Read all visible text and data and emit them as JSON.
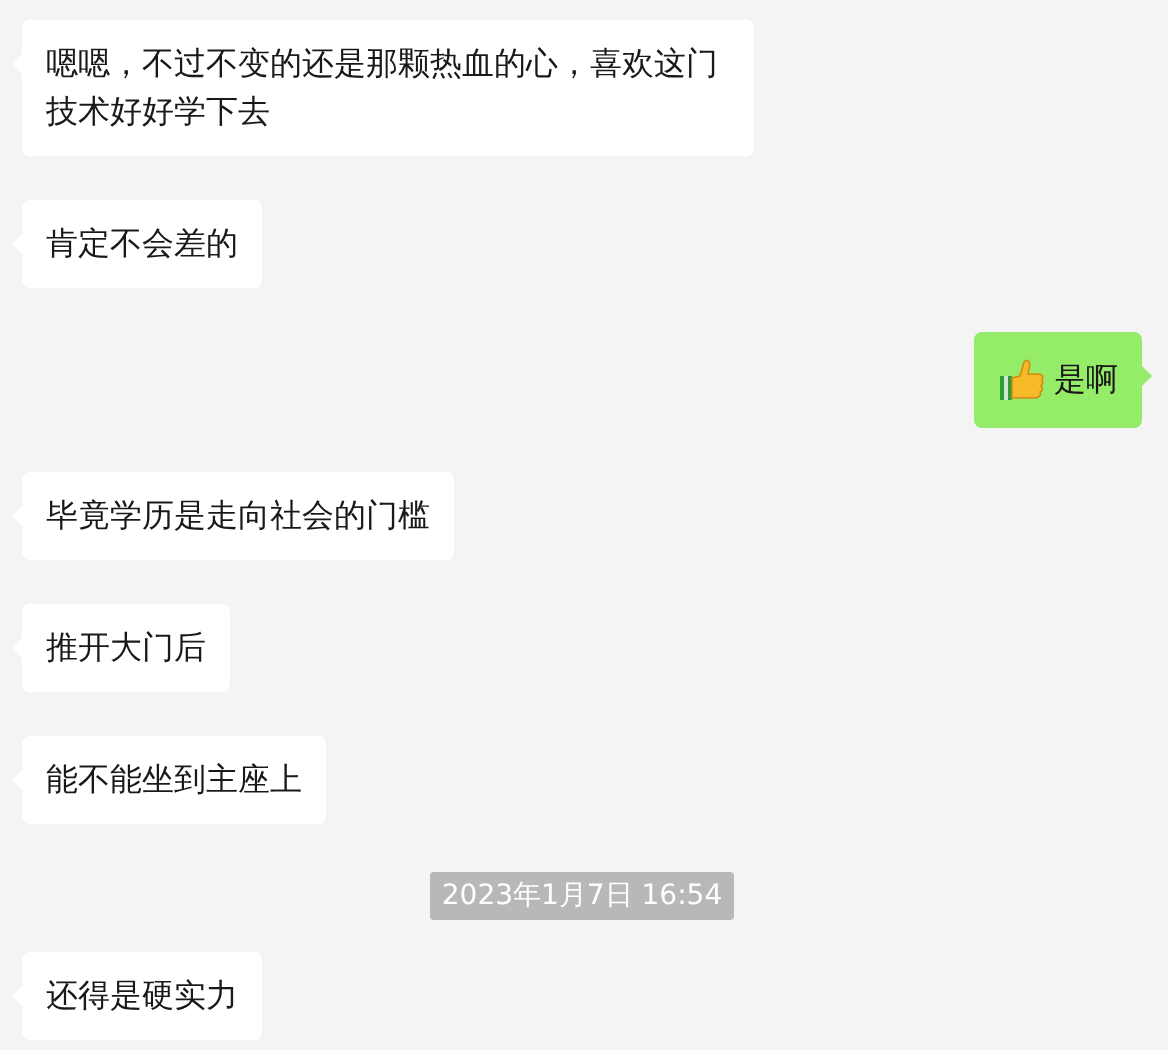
{
  "messages": [
    {
      "kind": "incoming",
      "text": "嗯嗯，不过不变的还是那颗热血的心，喜欢这门技术好好学下去"
    },
    {
      "kind": "incoming",
      "text": "肯定不会差的"
    },
    {
      "kind": "outgoing",
      "thumbs_up": true,
      "text": "是啊"
    },
    {
      "kind": "incoming",
      "text": "毕竟学历是走向社会的门槛"
    },
    {
      "kind": "incoming",
      "text": "推开大门后"
    },
    {
      "kind": "incoming",
      "text": "能不能坐到主座上"
    },
    {
      "kind": "timestamp",
      "text": "2023年1月7日 16:54"
    },
    {
      "kind": "incoming",
      "text": "还得是硬实力"
    }
  ]
}
